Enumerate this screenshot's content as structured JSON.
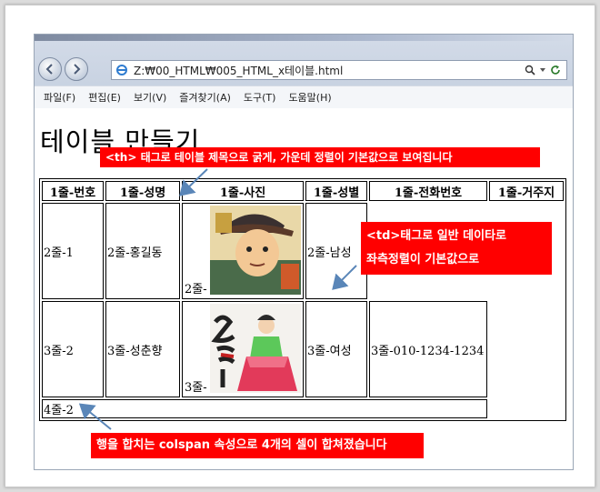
{
  "browser": {
    "address": "Z:₩00_HTML₩005_HTML_x테이블.html",
    "menu": [
      "파일(F)",
      "편집(E)",
      "보기(V)",
      "즐겨찾기(A)",
      "도구(T)",
      "도움말(H)"
    ]
  },
  "page": {
    "title": "테이블 만들기",
    "header": [
      "1줄-번호",
      "1줄-성명",
      "1줄-사진",
      "1줄-성별",
      "1줄-전화번호",
      "1줄-거주지"
    ],
    "row2": {
      "num": "2줄-1",
      "name": "2줄-홍길동",
      "photo_caption": "2줄-",
      "gender": "2줄-남성"
    },
    "row3": {
      "num": "3줄-2",
      "name": "3줄-성춘향",
      "photo_caption": "3줄-",
      "gender": "3줄-여성",
      "phone": "3줄-010-1234-1234"
    },
    "row4": {
      "text": "4줄-2"
    }
  },
  "callouts": {
    "th": "<th> 태그로 테이블 제목으로 굵게, 가운데 정렬이 기본값으로 보여집니다",
    "td_line1": "<td>태그로 일반 데이타로",
    "td_line2": "좌측정렬이 기본값으로",
    "colspan": "행을 합치는 colspan 속성으로 4개의 셀이 합쳐졌습니다"
  },
  "colors": {
    "callout_bg": "#ff0000",
    "arrow": "#5a86b8"
  }
}
